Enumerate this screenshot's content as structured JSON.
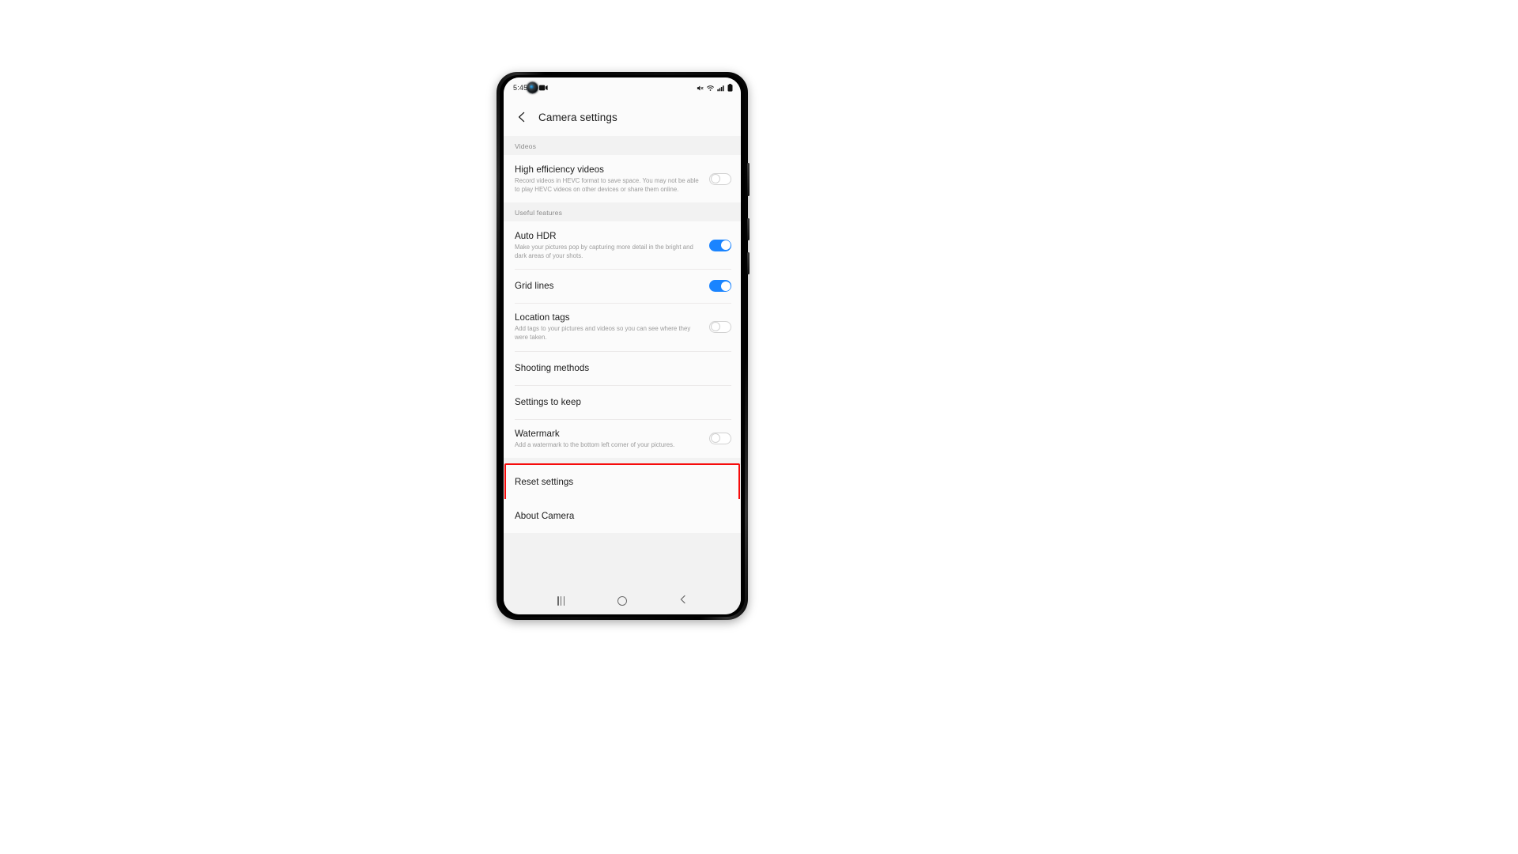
{
  "statusbar": {
    "clock": "5:45",
    "icons_left": [
      "screen-recorder-icon"
    ],
    "icons_right": [
      "mute-icon",
      "wifi-icon",
      "signal-icon",
      "battery-icon"
    ]
  },
  "header": {
    "back_label": "Back",
    "title": "Camera settings"
  },
  "sections": [
    {
      "heading": "Videos",
      "rows": [
        {
          "title": "High efficiency videos",
          "desc": "Record videos in HEVC format to save space. You may not be able to play HEVC videos on other devices or share them online.",
          "control": "toggle",
          "state": "off"
        }
      ]
    },
    {
      "heading": "Useful features",
      "rows": [
        {
          "title": "Auto HDR",
          "desc": "Make your pictures pop by capturing more detail in the bright and dark areas of your shots.",
          "control": "toggle",
          "state": "on"
        },
        {
          "title": "Grid lines",
          "desc": "",
          "control": "toggle",
          "state": "on"
        },
        {
          "title": "Location tags",
          "desc": "Add tags to your pictures and videos so you can see where they were taken.",
          "control": "toggle",
          "state": "off"
        },
        {
          "title": "Shooting methods",
          "desc": "",
          "control": "none",
          "state": ""
        },
        {
          "title": "Settings to keep",
          "desc": "",
          "control": "none",
          "state": ""
        },
        {
          "title": "Watermark",
          "desc": "Add a watermark to the bottom left corner of your pictures.",
          "control": "toggle",
          "state": "off"
        }
      ]
    }
  ],
  "footer_rows": [
    {
      "title": "Reset settings",
      "highlighted": true
    },
    {
      "title": "About Camera",
      "highlighted": false
    }
  ],
  "navbar": {
    "recents_label": "Recents",
    "home_label": "Home",
    "back_label": "Back"
  },
  "annotation": {
    "color": "#f60b0b",
    "target": "Reset settings"
  },
  "colors": {
    "accent_on": "#1a84ff",
    "page_bg": "#ffffff",
    "screen_bg": "#fbfbfb",
    "section_bg": "#f2f2f2",
    "title_text": "#1b1b1b",
    "desc_text": "#9b9b9b"
  }
}
